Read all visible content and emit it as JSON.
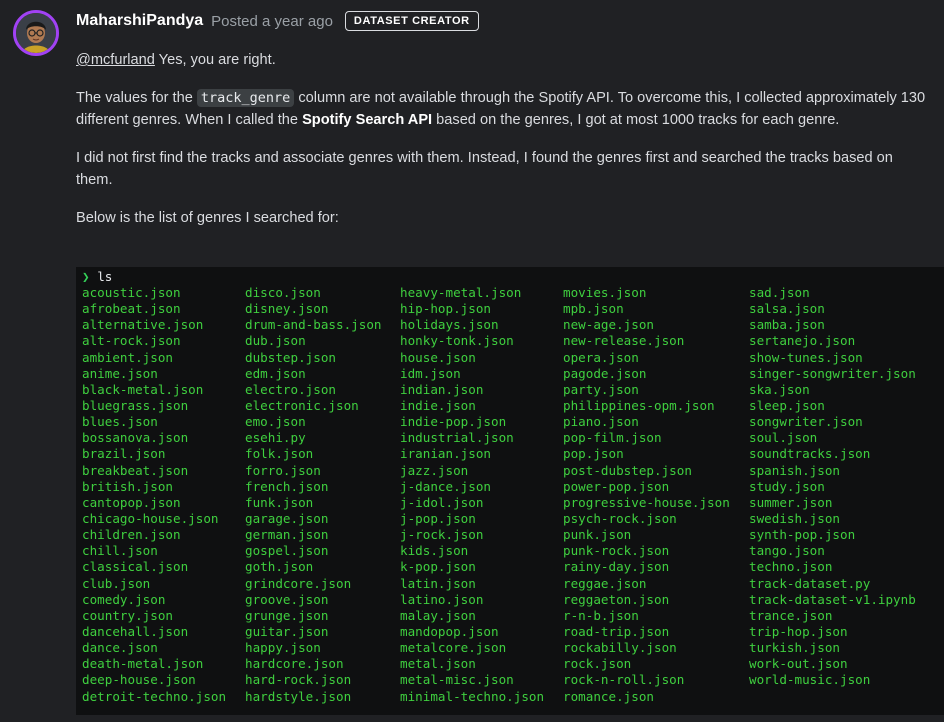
{
  "post": {
    "author": "MaharshiPandya",
    "posted": "Posted a year ago",
    "badge": "DATASET CREATOR",
    "mention": "@mcfurland",
    "p1_rest": " Yes, you are right.",
    "p2_a": "The values for the ",
    "p2_code": "track_genre",
    "p2_b": " column are not available through the Spotify API. To overcome this, I collected approximately 130 different genres. When I called the ",
    "p2_bold": "Spotify Search API",
    "p2_c": " based on the genres, I got at most 1000 tracks for each genre.",
    "p3": "I did not first find the tracks and associate genres with them. Instead, I found the genres first and searched the tracks based on them.",
    "p4": "Below is the list of genres I searched for:"
  },
  "terminal": {
    "prompt_symbol": "❯",
    "command": "ls",
    "columns": [
      [
        "acoustic.json",
        "afrobeat.json",
        "alternative.json",
        "alt-rock.json",
        "ambient.json",
        "anime.json",
        "black-metal.json",
        "bluegrass.json",
        "blues.json",
        "bossanova.json",
        "brazil.json",
        "breakbeat.json",
        "british.json",
        "cantopop.json",
        "chicago-house.json",
        "children.json",
        "chill.json",
        "classical.json",
        "club.json",
        "comedy.json",
        "country.json",
        "dancehall.json",
        "dance.json",
        "death-metal.json",
        "deep-house.json",
        "detroit-techno.json"
      ],
      [
        "disco.json",
        "disney.json",
        "drum-and-bass.json",
        "dub.json",
        "dubstep.json",
        "edm.json",
        "electro.json",
        "electronic.json",
        "emo.json",
        "esehi.py",
        "folk.json",
        "forro.json",
        "french.json",
        "funk.json",
        "garage.json",
        "german.json",
        "gospel.json",
        "goth.json",
        "grindcore.json",
        "groove.json",
        "grunge.json",
        "guitar.json",
        "happy.json",
        "hardcore.json",
        "hard-rock.json",
        "hardstyle.json"
      ],
      [
        "heavy-metal.json",
        "hip-hop.json",
        "holidays.json",
        "honky-tonk.json",
        "house.json",
        "idm.json",
        "indian.json",
        "indie.json",
        "indie-pop.json",
        "industrial.json",
        "iranian.json",
        "jazz.json",
        "j-dance.json",
        "j-idol.json",
        "j-pop.json",
        "j-rock.json",
        "kids.json",
        "k-pop.json",
        "latin.json",
        "latino.json",
        "malay.json",
        "mandopop.json",
        "metalcore.json",
        "metal.json",
        "metal-misc.json",
        "minimal-techno.json"
      ],
      [
        "movies.json",
        "mpb.json",
        "new-age.json",
        "new-release.json",
        "opera.json",
        "pagode.json",
        "party.json",
        "philippines-opm.json",
        "piano.json",
        "pop-film.json",
        "pop.json",
        "post-dubstep.json",
        "power-pop.json",
        "progressive-house.json",
        "psych-rock.json",
        "punk.json",
        "punk-rock.json",
        "rainy-day.json",
        "reggae.json",
        "reggaeton.json",
        "r-n-b.json",
        "road-trip.json",
        "rockabilly.json",
        "rock.json",
        "rock-n-roll.json",
        "romance.json"
      ],
      [
        "sad.json",
        "salsa.json",
        "samba.json",
        "sertanejo.json",
        "show-tunes.json",
        "singer-songwriter.json",
        "ska.json",
        "sleep.json",
        "songwriter.json",
        "soul.json",
        "soundtracks.json",
        "spanish.json",
        "study.json",
        "summer.json",
        "swedish.json",
        "synth-pop.json",
        "tango.json",
        "techno.json",
        "track-dataset.py",
        "track-dataset-v1.ipynb",
        "trance.json",
        "trip-hop.json",
        "turkish.json",
        "work-out.json",
        "world-music.json"
      ]
    ]
  },
  "colors": {
    "background": "#202124",
    "terminal_bg": "#0f1011",
    "file_green": "#3fcf3f",
    "avatar_ring": "#a142f4"
  }
}
